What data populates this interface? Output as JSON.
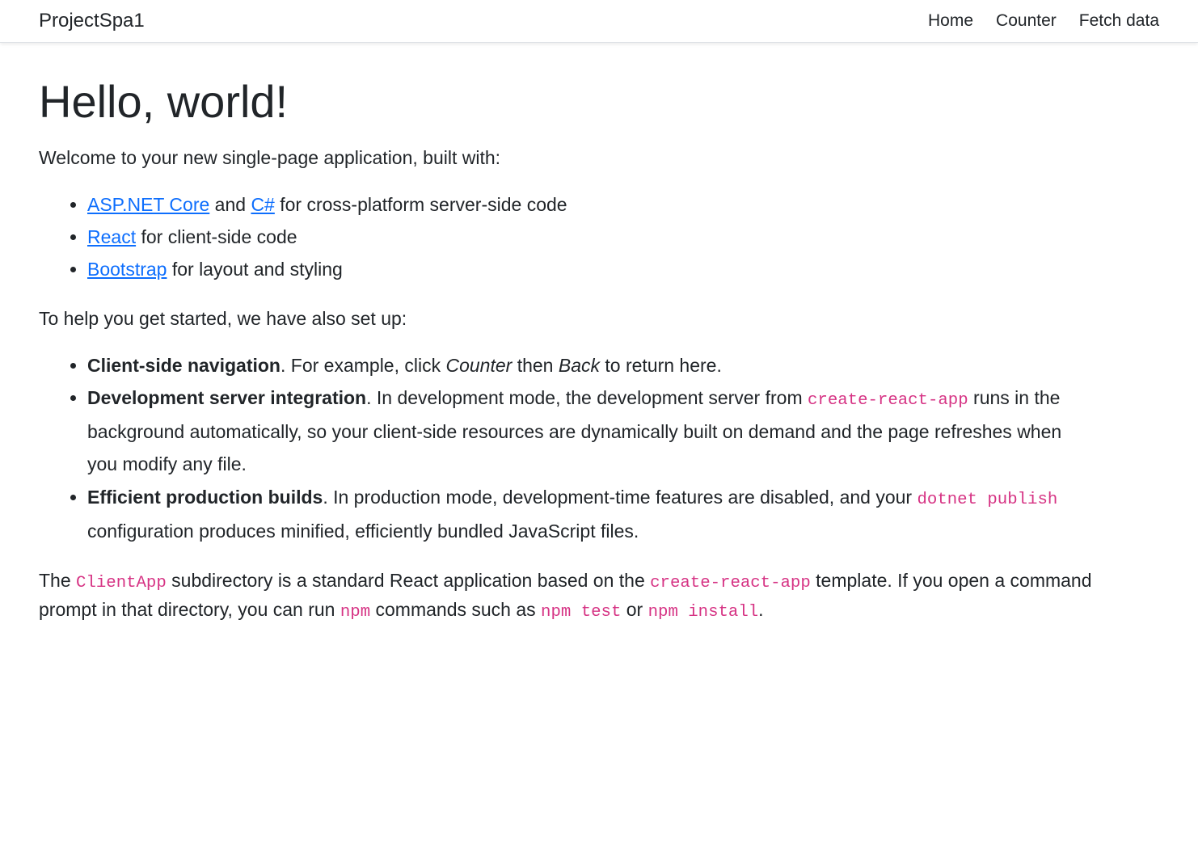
{
  "navbar": {
    "brand": "ProjectSpa1",
    "links": [
      "Home",
      "Counter",
      "Fetch data"
    ]
  },
  "main": {
    "heading": "Hello, world!",
    "intro": "Welcome to your new single-page application, built with:",
    "tech_list": [
      {
        "parts": [
          {
            "type": "link",
            "text": "ASP.NET Core"
          },
          {
            "type": "text",
            "text": " and "
          },
          {
            "type": "link",
            "text": "C#"
          },
          {
            "type": "text",
            "text": " for cross-platform server-side code"
          }
        ]
      },
      {
        "parts": [
          {
            "type": "link",
            "text": "React"
          },
          {
            "type": "text",
            "text": " for client-side code"
          }
        ]
      },
      {
        "parts": [
          {
            "type": "link",
            "text": "Bootstrap"
          },
          {
            "type": "text",
            "text": " for layout and styling"
          }
        ]
      }
    ],
    "setup_intro": "To help you get started, we have also set up:",
    "setup_list": [
      {
        "parts": [
          {
            "type": "strong",
            "text": "Client-side navigation"
          },
          {
            "type": "text",
            "text": ". For example, click "
          },
          {
            "type": "em",
            "text": "Counter"
          },
          {
            "type": "text",
            "text": " then "
          },
          {
            "type": "em",
            "text": "Back"
          },
          {
            "type": "text",
            "text": " to return here."
          }
        ]
      },
      {
        "parts": [
          {
            "type": "strong",
            "text": "Development server integration"
          },
          {
            "type": "text",
            "text": ". In development mode, the development server from "
          },
          {
            "type": "code",
            "text": "create-react-app"
          },
          {
            "type": "text",
            "text": " runs in the background automatically, so your client-side resources are dynamically built on demand and the page refreshes when you modify any file."
          }
        ]
      },
      {
        "parts": [
          {
            "type": "strong",
            "text": "Efficient production builds"
          },
          {
            "type": "text",
            "text": ". In production mode, development-time features are disabled, and your "
          },
          {
            "type": "code",
            "text": "dotnet publish"
          },
          {
            "type": "text",
            "text": " configuration produces minified, efficiently bundled JavaScript files."
          }
        ]
      }
    ],
    "footer_paragraph": {
      "parts": [
        {
          "type": "text",
          "text": "The "
        },
        {
          "type": "code",
          "text": "ClientApp"
        },
        {
          "type": "text",
          "text": " subdirectory is a standard React application based on the "
        },
        {
          "type": "code",
          "text": "create-react-app"
        },
        {
          "type": "text",
          "text": " template. If you open a command prompt in that directory, you can run "
        },
        {
          "type": "code",
          "text": "npm"
        },
        {
          "type": "text",
          "text": " commands such as "
        },
        {
          "type": "code",
          "text": "npm test"
        },
        {
          "type": "text",
          "text": " or "
        },
        {
          "type": "code",
          "text": "npm install"
        },
        {
          "type": "text",
          "text": "."
        }
      ]
    }
  }
}
